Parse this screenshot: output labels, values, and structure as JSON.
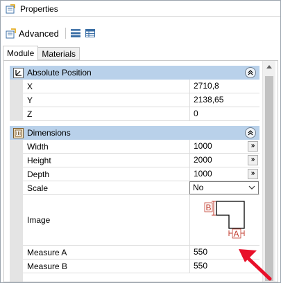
{
  "window": {
    "title": "Properties",
    "title_icon": "properties-icon"
  },
  "toolbar": {
    "advanced_label": "Advanced",
    "advanced_icon": "advanced-properties-icon",
    "buttons": [
      {
        "icon": "categorized-view-icon"
      },
      {
        "icon": "table-view-icon"
      }
    ]
  },
  "tabs": [
    {
      "label": "Module",
      "active": true
    },
    {
      "label": "Materials",
      "active": false
    }
  ],
  "sections": {
    "absolute_position": {
      "title": "Absolute Position",
      "icon": "position-axes-icon",
      "rows": [
        {
          "label": "X",
          "value": "2710,8"
        },
        {
          "label": "Y",
          "value": "2138,65"
        },
        {
          "label": "Z",
          "value": "0"
        }
      ]
    },
    "dimensions": {
      "title": "Dimensions",
      "icon": "dimensions-icon",
      "rows": [
        {
          "label": "Width",
          "value": "1000",
          "button": "»"
        },
        {
          "label": "Height",
          "value": "2000",
          "button": "»"
        },
        {
          "label": "Depth",
          "value": "1000",
          "button": "»"
        },
        {
          "label": "Scale",
          "value": "No",
          "type": "select"
        },
        {
          "label": "Image",
          "type": "image"
        },
        {
          "label": "Measure A",
          "value": "550"
        },
        {
          "label": "Measure B",
          "value": "550"
        }
      ],
      "image_labels": {
        "a": "A",
        "b": "B"
      }
    }
  },
  "colors": {
    "section_header": "#b9d1ea",
    "annotation_arrow": "#e8102a",
    "diagram_measure": "#c0392b"
  }
}
